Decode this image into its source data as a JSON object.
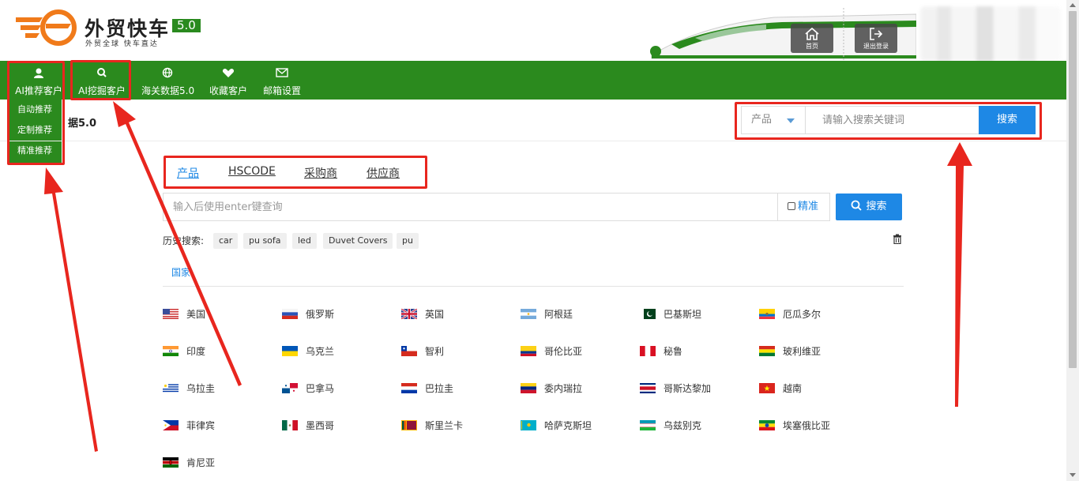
{
  "brand": {
    "title": "外贸快车",
    "version": "5.0",
    "subtitle": "外贸全球 快车直达"
  },
  "header_buttons": {
    "home_label": "首页",
    "logout_label": "退出登录"
  },
  "nav": {
    "items": [
      {
        "label": "AI推荐客户",
        "icon": "user-icon"
      },
      {
        "label": "AI挖掘客户",
        "icon": "search-icon"
      },
      {
        "label": "海关数据5.0",
        "icon": "globe-icon"
      },
      {
        "label": "收藏客户",
        "icon": "heart-icon"
      },
      {
        "label": "邮箱设置",
        "icon": "mail-icon"
      }
    ],
    "dropdown": [
      "自动推荐",
      "定制推荐",
      "精准推荐"
    ]
  },
  "page": {
    "subtitle_visible": "据5.0"
  },
  "top_search": {
    "select_value": "产品",
    "placeholder": "请输入搜索关键词",
    "button": "搜索"
  },
  "tabs": [
    "产品",
    "HSCODE",
    "采购商",
    "供应商"
  ],
  "main_search": {
    "placeholder": "输入后使用enter键查询",
    "exact_label": "精准",
    "button": "搜索"
  },
  "history": {
    "label": "历史搜索:",
    "items": [
      "car",
      "pu sofa",
      "led",
      "Duvet Covers",
      "pu"
    ]
  },
  "country_tab": "国家",
  "countries": [
    "美国",
    "俄罗斯",
    "英国",
    "阿根廷",
    "巴基斯坦",
    "厄瓜多尔",
    "印度",
    "乌克兰",
    "智利",
    "哥伦比亚",
    "秘鲁",
    "玻利维亚",
    "乌拉圭",
    "巴拿马",
    "巴拉圭",
    "委内瑞拉",
    "哥斯达黎加",
    "越南",
    "菲律宾",
    "墨西哥",
    "斯里兰卡",
    "哈萨克斯坦",
    "乌兹别克",
    "埃塞俄比亚",
    "肯尼亚"
  ],
  "colors": {
    "nav_green": "#2b8a1e",
    "accent_blue": "#1e88e5",
    "annotation_red": "#e8261e"
  }
}
